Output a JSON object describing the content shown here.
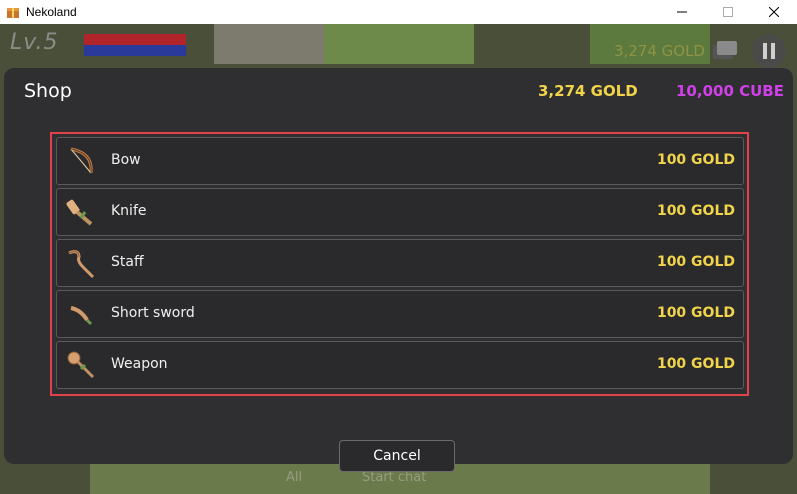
{
  "window": {
    "title": "Nekoland",
    "icon": "gift-box-icon"
  },
  "hud": {
    "level": "Lv.5",
    "gold_background": "3,274 GOLD"
  },
  "shop": {
    "title": "Shop",
    "gold": "3,274 GOLD",
    "cube": "10,000 CUBE",
    "items": [
      {
        "name": "Bow",
        "price": "100 GOLD",
        "icon": "bow-icon"
      },
      {
        "name": "Knife",
        "price": "100 GOLD",
        "icon": "knife-icon"
      },
      {
        "name": "Staff",
        "price": "100 GOLD",
        "icon": "staff-icon"
      },
      {
        "name": "Short sword",
        "price": "100 GOLD",
        "icon": "short-sword-icon"
      },
      {
        "name": "Weapon",
        "price": "100 GOLD",
        "icon": "mace-icon"
      }
    ],
    "cancel_label": "Cancel"
  },
  "bottom_bar": {
    "tab_all": "All",
    "start_chat": "Start chat"
  },
  "colors": {
    "gold": "#f1d44a",
    "cube": "#d040e8",
    "highlight_border": "#e0444a",
    "panel": "#2f2f31"
  }
}
